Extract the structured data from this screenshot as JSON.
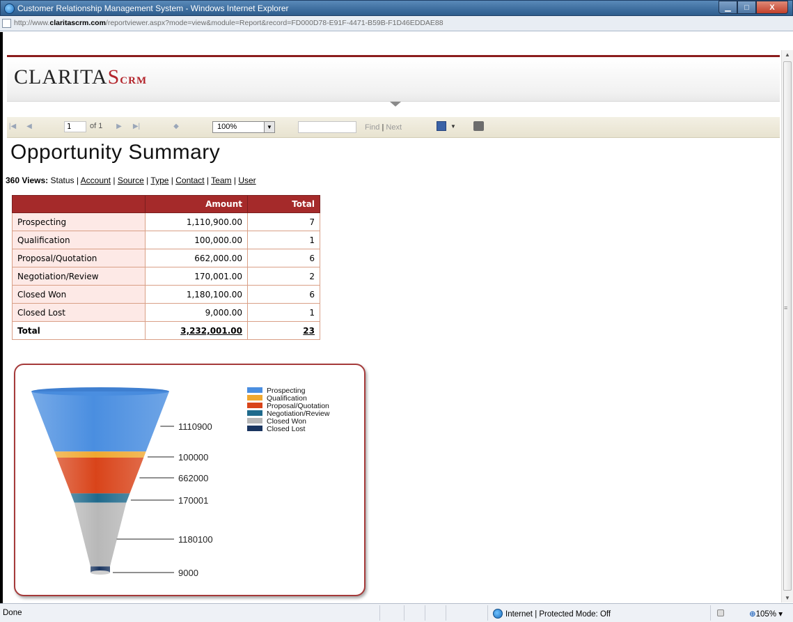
{
  "window": {
    "title": "Customer Relationship Management System - Windows Internet Explorer",
    "url_prefix": "http://www.",
    "url_domain": "claritascrm.com",
    "url_path": "/reportviewer.aspx?mode=view&module=Report&record=FD000D78-E91F-4471-B59B-F1D46EDDAE88",
    "min_label": "▁",
    "max_label": "□",
    "close_label": "X"
  },
  "logo": {
    "main": "CLARITA",
    "accent": "S",
    "suffix": "CRM"
  },
  "toolbar": {
    "page_value": "1",
    "of_label": "of 1",
    "zoom_value": "100%",
    "find_label": "Find",
    "separator": "|",
    "next_label": "Next"
  },
  "report": {
    "title": "Opportunity Summary",
    "views_label": "360 Views:",
    "views": [
      {
        "label": "Status",
        "current": true
      },
      {
        "label": "Account",
        "current": false
      },
      {
        "label": "Source",
        "current": false
      },
      {
        "label": "Type",
        "current": false
      },
      {
        "label": "Contact",
        "current": false
      },
      {
        "label": "Team",
        "current": false
      },
      {
        "label": "User",
        "current": false
      }
    ],
    "table": {
      "headers": [
        "",
        "Amount",
        "Total"
      ],
      "rows": [
        {
          "label": "Prospecting",
          "amount": "1,110,900.00",
          "total": "7"
        },
        {
          "label": "Qualification",
          "amount": "100,000.00",
          "total": "1"
        },
        {
          "label": "Proposal/Quotation",
          "amount": "662,000.00",
          "total": "6"
        },
        {
          "label": "Negotiation/Review",
          "amount": "170,001.00",
          "total": "2"
        },
        {
          "label": "Closed Won",
          "amount": "1,180,100.00",
          "total": "6"
        },
        {
          "label": "Closed Lost",
          "amount": "9,000.00",
          "total": "1"
        }
      ],
      "total_row": {
        "label": "Total",
        "amount": "3,232,001.00",
        "total": "23"
      }
    }
  },
  "chart_data": {
    "type": "funnel",
    "categories": [
      "Prospecting",
      "Qualification",
      "Proposal/Quotation",
      "Negotiation/Review",
      "Closed Won",
      "Closed Lost"
    ],
    "values": [
      1110900,
      100000,
      662000,
      170001,
      1180100,
      9000
    ],
    "data_labels": [
      "1110900",
      "100000",
      "662000",
      "170001",
      "1180100",
      "9000"
    ],
    "colors": [
      "#4a8ee0",
      "#f0a830",
      "#d9441a",
      "#1f6a8c",
      "#b8b8b8",
      "#1a3560"
    ],
    "legend_position": "top-right"
  },
  "status": {
    "text": "Done",
    "zone": "Internet | Protected Mode: Off",
    "zoom": "105%"
  }
}
